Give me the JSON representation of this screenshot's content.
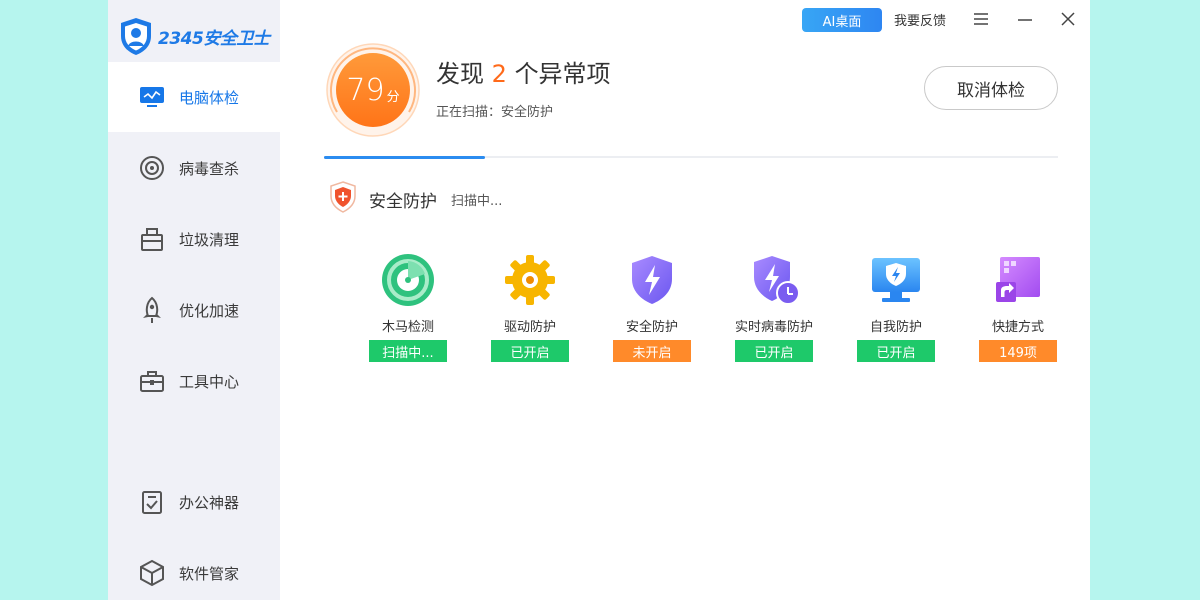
{
  "app": {
    "logo_text": "2345安全卫士"
  },
  "topbar": {
    "ai_label": "AI桌面",
    "feedback_label": "我要反馈",
    "menu_icon": "menu-icon",
    "minimize_icon": "minimize-icon",
    "close_icon": "close-icon"
  },
  "sidebar": {
    "items": [
      {
        "label": "电脑体检",
        "icon": "monitor-icon",
        "active": true
      },
      {
        "label": "病毒查杀",
        "icon": "target-icon",
        "active": false
      },
      {
        "label": "垃圾清理",
        "icon": "trash-box-icon",
        "active": false
      },
      {
        "label": "优化加速",
        "icon": "rocket-icon",
        "active": false
      },
      {
        "label": "工具中心",
        "icon": "toolbox-icon",
        "active": false
      },
      {
        "label": "办公神器",
        "icon": "clipboard-check-icon",
        "active": false
      },
      {
        "label": "软件管家",
        "icon": "cube-icon",
        "active": false
      }
    ]
  },
  "scan": {
    "score": "79",
    "score_unit": "分",
    "headline_prefix": "发现",
    "issue_count": "2",
    "headline_suffix": "个异常项",
    "status_text": "正在扫描：安全防护",
    "cancel_label": "取消体检",
    "progress": 0.22
  },
  "section": {
    "title": "安全防护",
    "status": "扫描中..."
  },
  "items": [
    {
      "label": "木马检测",
      "badge": "扫描中...",
      "icon": "radar-icon"
    },
    {
      "label": "驱动防护",
      "badge": "已开启",
      "icon": "gear-icon"
    },
    {
      "label": "安全防护",
      "badge": "未开启",
      "icon": "shield-lightning-icon"
    },
    {
      "label": "实时病毒防护",
      "badge": "已开启",
      "icon": "shield-clock-icon"
    },
    {
      "label": "自我防护",
      "badge": "已开启",
      "icon": "monitor-shield-icon"
    },
    {
      "label": "快捷方式",
      "badge": "149项",
      "icon": "shortcut-icon"
    }
  ],
  "colors": {
    "accent": "#1677e8",
    "badge_green": "#1ec96a",
    "badge_orange": "#ff8a2a",
    "issue_orange": "#ff6a1a"
  }
}
